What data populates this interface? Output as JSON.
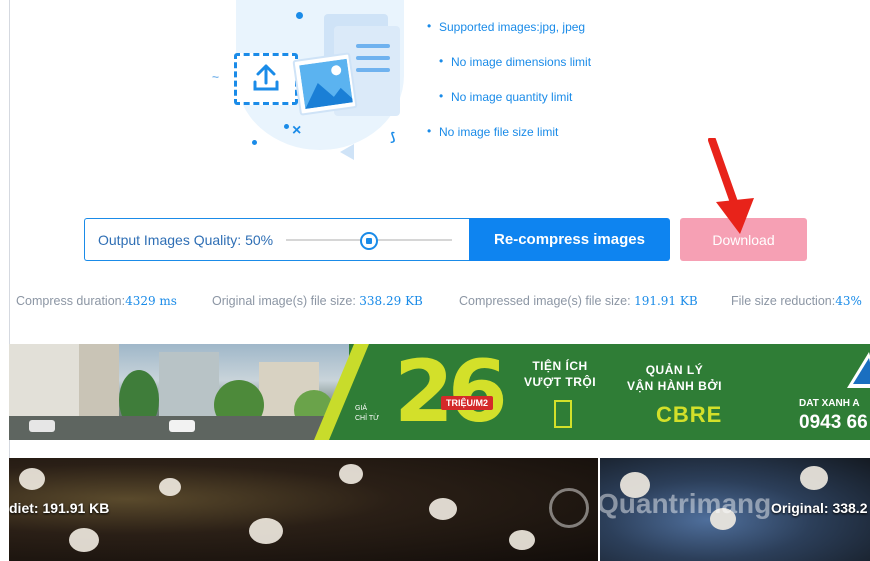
{
  "features": [
    "Supported images:jpg, jpeg",
    "No image dimensions limit",
    "No image quantity limit",
    "No image file size limit"
  ],
  "quality": {
    "label": "Output Images Quality: 50%",
    "value_percent": 50
  },
  "buttons": {
    "recompress": "Re-compress images",
    "download": "Download"
  },
  "stats": {
    "duration_label": "Compress duration:",
    "duration_value": "4329 ms",
    "original_label": "Original image(s) file size: ",
    "original_value": "338.29 KB",
    "compressed_label": "Compressed image(s) file size: ",
    "compressed_value": "191.91 KB",
    "reduction_label": "File size reduction:",
    "reduction_value": "43%"
  },
  "banner": {
    "big_number": "26",
    "price_prefix": "GIÁ\nCHỈ TỪ",
    "price_unit": "TRIỆU/M2",
    "feature_1": "TIỆN ÍCH\nVƯỢT TRỘI",
    "feature_2": "QUẢN LÝ\nVẬN HÀNH BỞI",
    "operator": "CBRE",
    "brand": "DAT XANH A",
    "phone": "0943 66"
  },
  "compare": {
    "left_label": "diet: 191.91 KB",
    "right_label": "Original: 338.2",
    "watermark": "Quantrimang"
  },
  "colors": {
    "accent": "#1a8be8",
    "primary_button": "#0e84f0",
    "download_button": "#f6a0b4",
    "annotation_arrow": "#e8231a",
    "banner_green": "#2f7d36",
    "banner_lime": "#d3e02a"
  },
  "icons": {
    "upload": "upload-icon",
    "image": "image-icon",
    "document": "document-icon",
    "arrow": "red-arrow-annotation"
  }
}
